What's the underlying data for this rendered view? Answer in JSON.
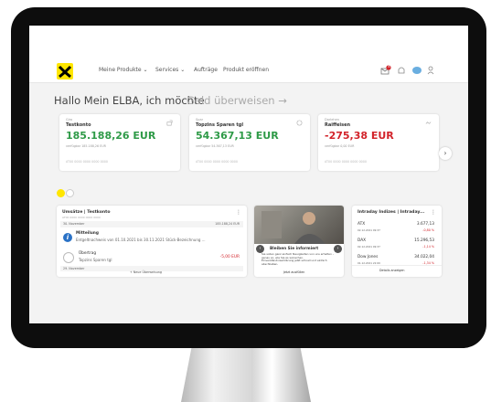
{
  "nav": {
    "items": [
      "Meine Produkte",
      "Services",
      "Aufträge",
      "Produkt eröffnen"
    ],
    "mail_badge": "8"
  },
  "headline": {
    "text": "Hallo Mein ELBA, ich möchte",
    "action": "Geld überweisen →"
  },
  "accounts": [
    {
      "type": "Giro",
      "name": "Testkonto",
      "amount": "185.188,26 EUR",
      "available": "verfügbar 185.188,26 EUR",
      "iban": "AT00 0000 0000 0000 0000",
      "amount_color": "#2e9a47"
    },
    {
      "type": "Spar",
      "name": "Topzins Sparen tgl",
      "amount": "54.367,13 EUR",
      "available": "verfügbar 54.367,13 EUR",
      "iban": "AT00 0000 0000 0000 0000",
      "amount_color": "#2e9a47"
    },
    {
      "type": "Darlehen",
      "name": "Raiffeisen",
      "amount": "-275,38 EUR",
      "available": "verfügbar 0,00 EUR",
      "iban": "AT00 0000 0000 0000 0000",
      "amount_color": "#d2232a"
    }
  ],
  "transactions": {
    "title": "Umsätze | Testkonto",
    "subtitle": "AT00 0000 0000 0000 0000",
    "date1": "30. November",
    "balance": "185.188,24 EUR",
    "item1_title": "Mitteilung",
    "item1_text": "Entgeltnachweis von 01.10.2021 bis 30.11.2021 Stück-Bezeichnung ...",
    "item2_title": "Übertrag",
    "item2_text": "Topzins Sparen tgl",
    "item2_amount": "-5,00 EUR",
    "date2": "29. November",
    "new_transfer": "+ Neue Überweisung"
  },
  "promo": {
    "title": "Bleiben Sie informiert",
    "text": "Sie sollen ganz einfach Neuigkeiten von uns erhalten – genau so, wie Sie es wünschen. Einverständniserklärung jetzt schnell und einfach abschließen.",
    "link": "Jetzt ausfüllen"
  },
  "indices": {
    "title": "Intraday Indizes | Intraday...",
    "rows": [
      {
        "name": "ATX",
        "date": "02.12.2021 09:37",
        "value": "3.677,13",
        "change": "-0,80 %"
      },
      {
        "name": "DAX",
        "date": "02.12.2021 09:37",
        "value": "15.296,53",
        "change": "-1,14 %"
      },
      {
        "name": "Dow Jones",
        "date": "01.12.2021 22:00",
        "value": "34.022,04",
        "change": "-1,34 %"
      }
    ],
    "link": "Details anzeigen"
  }
}
